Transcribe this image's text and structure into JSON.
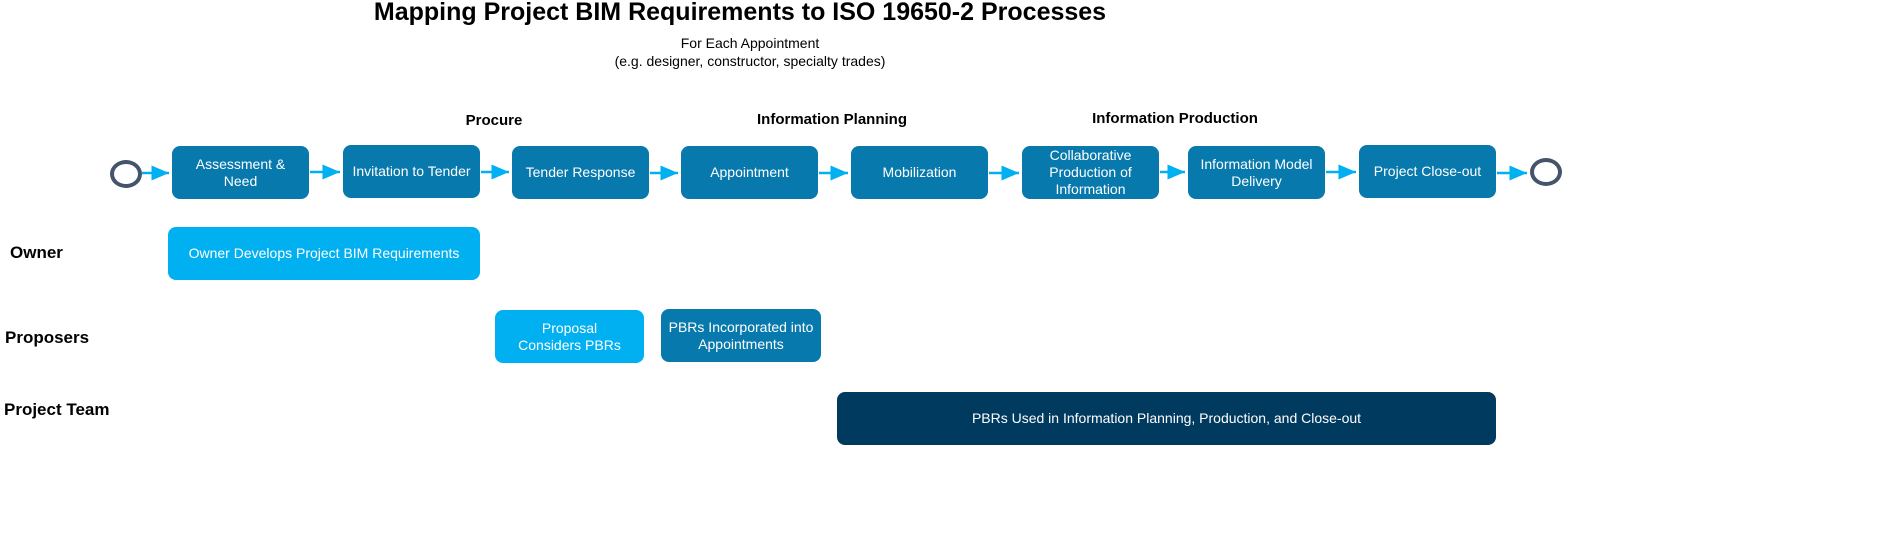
{
  "diagram": {
    "title": "Mapping Project BIM Requirements to ISO 19650-2 Processes",
    "subtitle_line1": "For Each Appointment",
    "subtitle_line2": "(e.g. designer, constructor, specialty trades)",
    "phases": [
      "Procure",
      "Information Planning",
      "Information Production"
    ],
    "process_steps": [
      "Assessment & Need",
      "Invitation to Tender",
      "Tender Response",
      "Appointment",
      "Mobilization",
      "Collaborative Production of Information",
      "Information Model Delivery",
      "Project Close-out"
    ],
    "start_event": "start-circle",
    "end_event": "end-circle",
    "lanes": [
      {
        "label": "Owner",
        "activities": [
          "Owner Develops Project BIM Requirements"
        ]
      },
      {
        "label": "Proposers",
        "activities": [
          "Proposal Considers PBRs",
          "PBRs Incorporated into Appointments"
        ]
      },
      {
        "label": "Project Team",
        "activities": [
          "PBRs Used in Information Planning, Production, and Close-out"
        ]
      }
    ],
    "colors": {
      "process": "#0779ac",
      "light_activity": "#00b0f0",
      "dark_activity": "#003a5f",
      "arrow": "#00b0f0",
      "event_circle": "#44546a"
    }
  }
}
